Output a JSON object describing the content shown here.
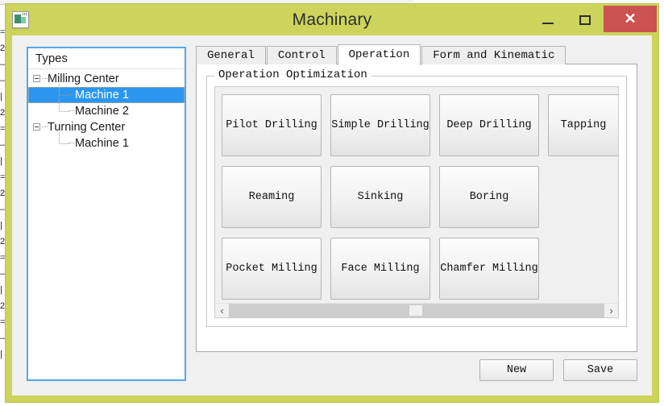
{
  "window": {
    "title": "Machinary",
    "icon": "app-document-icon",
    "titlebar_color": "#ccd45c",
    "close_color": "#cb5352",
    "controls": {
      "minimize": "—",
      "maximize": "□",
      "close": "✕"
    }
  },
  "tree": {
    "header": "Types",
    "nodes": [
      {
        "label": "Milling Center",
        "level": "root",
        "expander": "minus",
        "selected": false
      },
      {
        "label": "Machine 1",
        "level": "child",
        "expander": "none",
        "selected": true
      },
      {
        "label": "Machine 2",
        "level": "child",
        "expander": "none",
        "selected": false
      },
      {
        "label": "Turning Center",
        "level": "root",
        "expander": "minus",
        "selected": false
      },
      {
        "label": "Machine 1",
        "level": "child",
        "expander": "none",
        "selected": false
      }
    ],
    "selection_color": "#2b96ef",
    "focus_border_color": "#52a7ec"
  },
  "tabs": [
    {
      "label": "General",
      "active": false
    },
    {
      "label": "Control",
      "active": false
    },
    {
      "label": "Operation",
      "active": true
    },
    {
      "label": "Form and Kinematic",
      "active": false
    }
  ],
  "group": {
    "legend": "Operation Optimization"
  },
  "operations": {
    "rows": [
      [
        {
          "label": "Pilot Drilling",
          "width": "wide"
        },
        {
          "label": "Simple Drilling",
          "width": "wide"
        },
        {
          "label": "Deep Drilling",
          "width": "wide"
        },
        {
          "label": "Tapping",
          "width": "narrow"
        }
      ],
      [
        {
          "label": "Reaming",
          "width": "wide"
        },
        {
          "label": "Sinking",
          "width": "wide"
        },
        {
          "label": "Boring",
          "width": "wide"
        }
      ],
      [
        {
          "label": "Pocket Milling",
          "width": "wide"
        },
        {
          "label": "Face Milling",
          "width": "wide"
        },
        {
          "label": "Chamfer Milling",
          "width": "wide"
        }
      ]
    ]
  },
  "scrollbar": {
    "left_arrow": "‹",
    "right_arrow": "›",
    "thumb_position_percent": 48
  },
  "footer": {
    "new_label": "New",
    "save_label": "Save"
  },
  "background": {
    "left_fragments": [
      "=",
      "2",
      "—",
      "—",
      "|",
      "2",
      "=",
      "—",
      "|",
      "=",
      "2",
      "—",
      "|",
      "2",
      "=",
      "—",
      "|",
      "2",
      "=",
      "—",
      "|"
    ]
  }
}
